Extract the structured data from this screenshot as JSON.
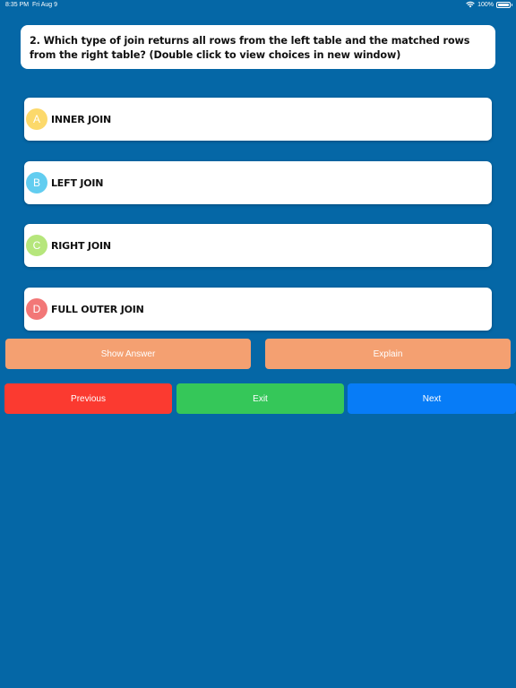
{
  "status_bar": {
    "time": "8:35 PM",
    "date": "Fri Aug 9",
    "battery": "100%"
  },
  "question": {
    "text": "2. Which type of join returns all rows from the left table and the matched rows from the right table? (Double click to view choices in new window)"
  },
  "choices": [
    {
      "letter": "A",
      "label": "INNER JOIN",
      "color": "#fcd96b"
    },
    {
      "letter": "B",
      "label": "LEFT JOIN",
      "color": "#62cdf0"
    },
    {
      "letter": "C",
      "label": "RIGHT JOIN",
      "color": "#b6e67c"
    },
    {
      "letter": "D",
      "label": "FULL OUTER JOIN",
      "color": "#f27777"
    }
  ],
  "buttons": {
    "show_answer": "Show Answer",
    "explain": "Explain",
    "previous": "Previous",
    "exit": "Exit",
    "next": "Next"
  },
  "colors": {
    "background": "#0567a6",
    "show_answer": "#f4a071",
    "explain": "#f4a071",
    "previous": "#fb3a30",
    "exit": "#35c759",
    "next": "#077cf7"
  },
  "icons": {
    "wifi": "wifi-icon",
    "battery": "battery-icon"
  }
}
